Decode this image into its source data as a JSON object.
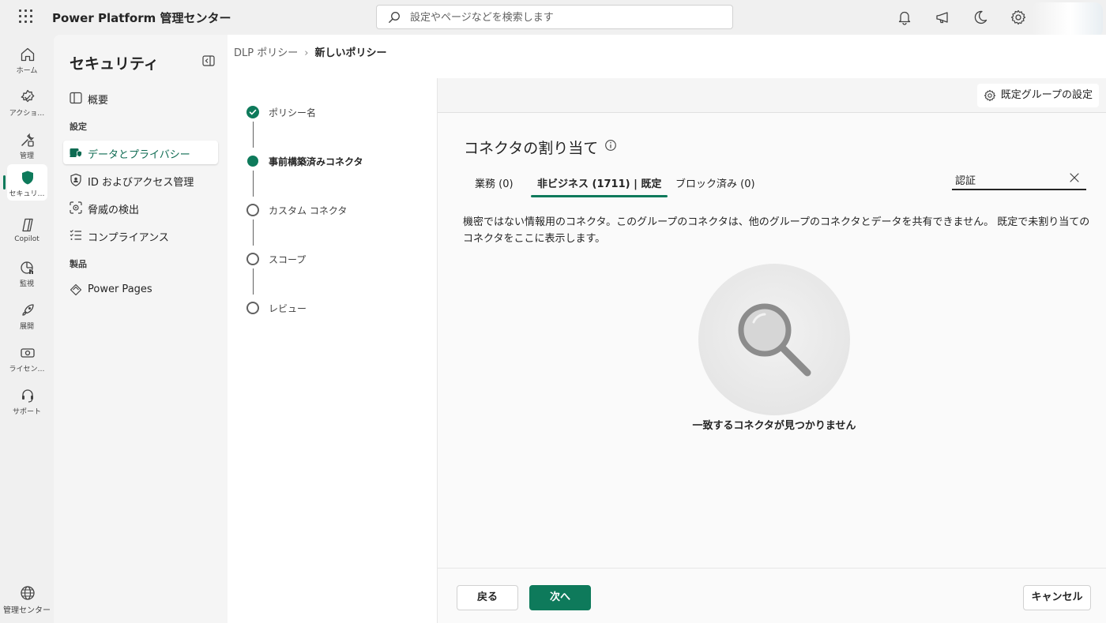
{
  "app": {
    "title": "Power Platform 管理センター",
    "search_placeholder": "設定やページなどを検索します"
  },
  "rail": {
    "items": [
      {
        "label": "ホーム",
        "icon": "home-icon"
      },
      {
        "label": "アクショ…",
        "icon": "action-icon"
      },
      {
        "label": "管理",
        "icon": "manage-icon"
      },
      {
        "label": "セキュリ…",
        "icon": "shield-icon",
        "active": true
      },
      {
        "label": "Copilot",
        "icon": "copilot-icon"
      },
      {
        "label": "監視",
        "icon": "monitor-icon"
      },
      {
        "label": "展開",
        "icon": "rocket-icon"
      },
      {
        "label": "ライセン…",
        "icon": "license-icon"
      },
      {
        "label": "サポート",
        "icon": "support-icon"
      }
    ],
    "bottom_label": "管理センター"
  },
  "security": {
    "title": "セキュリティ",
    "overview": "概要",
    "settings_header": "設定",
    "items": [
      "データとプライバシー",
      "ID およびアクセス管理",
      "脅威の検出",
      "コンプライアンス"
    ],
    "products_header": "製品",
    "products": [
      "Power Pages"
    ]
  },
  "breadcrumb": {
    "parent": "DLP ポリシー",
    "current": "新しいポリシー"
  },
  "steps": [
    {
      "label": "ポリシー名",
      "state": "done"
    },
    {
      "label": "事前構築済みコネクタ",
      "state": "current"
    },
    {
      "label": "カスタム コネクタ",
      "state": "todo"
    },
    {
      "label": "スコープ",
      "state": "todo"
    },
    {
      "label": "レビュー",
      "state": "todo"
    }
  ],
  "content": {
    "default_group_label": "既定グループの設定",
    "title": "コネクタの割り当て",
    "tabs": [
      "業務 (0)",
      "非ビジネス (1711) | 既定",
      "ブロック済み (0)"
    ],
    "active_tab": 1,
    "filter_value": "認証",
    "description": "機密ではない情報用のコネクタ。このグループのコネクタは、他のグループのコネクタとデータを共有できません。 既定で未割り当てのコネクタをここに表示します。",
    "empty_message": "一致するコネクタが見つかりません"
  },
  "footer": {
    "back": "戻る",
    "next": "次へ",
    "cancel": "キャンセル"
  },
  "colors": {
    "accent": "#0e7a5b"
  }
}
